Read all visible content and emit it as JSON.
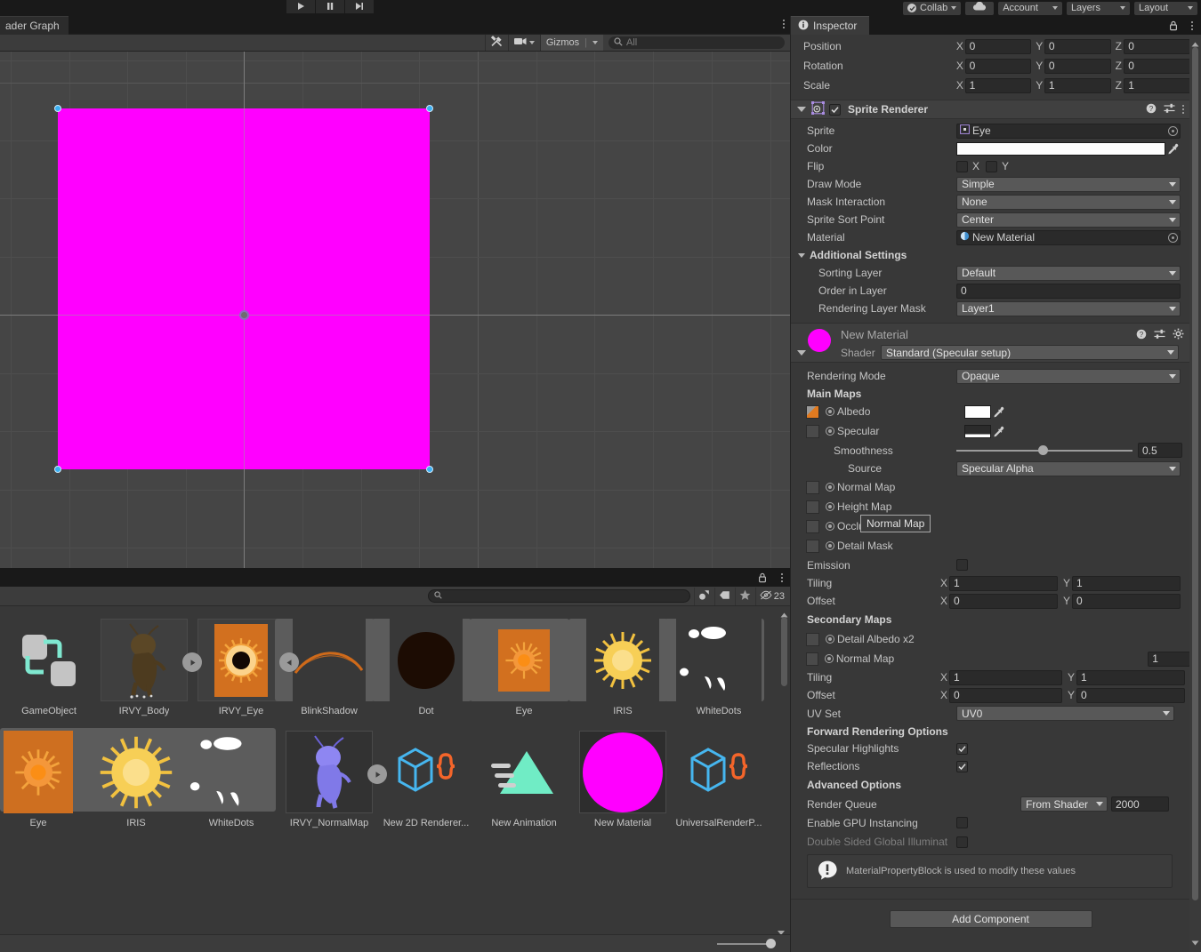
{
  "toolbar": {
    "play_icon": "play-icon",
    "pause_icon": "pause-icon",
    "step_icon": "step-icon",
    "collab_label": "Collab",
    "cloud_icon": "cloud-icon",
    "account_label": "Account",
    "layers_label": "Layers",
    "layout_label": "Layout"
  },
  "scene_panel": {
    "tab_label": "ader Graph",
    "tools_icon": "tools-icon",
    "camera_icon": "camera-icon",
    "gizmos_label": "Gizmos",
    "search_placeholder": "All",
    "search_icon": "search-icon",
    "sprite_color": "#ff00ff"
  },
  "project_panel": {
    "search_placeholder": "",
    "search_icon": "search-icon",
    "icon_filter_label": "filter-by-type-icon",
    "icon_label_label": "filter-by-label-icon",
    "icon_favorite_label": "favorite-star-icon",
    "hidden_icon": "hidden-eye-icon",
    "hidden_count": "23",
    "rows": [
      {
        "items": [
          {
            "name": "GameObject",
            "kind": "prefab",
            "selected": false
          },
          {
            "name": "IRVY_Body",
            "kind": "sprite-body",
            "selected": false,
            "badge": "play"
          },
          {
            "name": "IRVY_Eye",
            "kind": "sprite-eye",
            "selected": false,
            "badge": "back"
          },
          {
            "name": "BlinkShadow",
            "kind": "blink-shadow",
            "selected": false
          },
          {
            "name": "Dot",
            "kind": "dot",
            "selected": false
          },
          {
            "name": "Eye",
            "kind": "eye",
            "selected": false
          },
          {
            "name": "IRIS",
            "kind": "iris",
            "selected": false
          },
          {
            "name": "WhiteDots",
            "kind": "whitedots",
            "selected": false
          }
        ]
      },
      {
        "items": [
          {
            "name": "Eye",
            "kind": "eye",
            "selected": true
          },
          {
            "name": "IRIS",
            "kind": "iris",
            "selected": true
          },
          {
            "name": "WhiteDots",
            "kind": "whitedots",
            "selected": true
          },
          {
            "name": "IRVY_NormalMap",
            "kind": "normalmap-body",
            "selected": false,
            "badge": "play"
          },
          {
            "name": "New 2D Renderer...",
            "kind": "asset-json",
            "selected": false
          },
          {
            "name": "New Animation",
            "kind": "animation",
            "selected": false
          },
          {
            "name": "New Material",
            "kind": "material",
            "selected": true
          },
          {
            "name": "UniversalRenderP...",
            "kind": "asset-json",
            "selected": false
          }
        ]
      }
    ]
  },
  "inspector": {
    "tab_label": "Inspector",
    "info_icon": "info-icon",
    "lock_icon": "lock-icon",
    "kebab_icon": "kebab-icon",
    "transform": {
      "rows": [
        {
          "label": "Position",
          "x": "0",
          "y": "0",
          "z": "0"
        },
        {
          "label": "Rotation",
          "x": "0",
          "y": "0",
          "z": "0"
        },
        {
          "label": "Scale",
          "x": "1",
          "y": "1",
          "z": "1"
        }
      ],
      "axis_x": "X",
      "axis_y": "Y",
      "axis_z": "Z"
    },
    "sprite_renderer": {
      "title": "Sprite Renderer",
      "enabled": true,
      "icon": "sprite-renderer-icon",
      "help_icon": "help-icon",
      "preset_icon": "preset-icon",
      "kebab_icon": "kebab-icon",
      "sprite_label": "Sprite",
      "sprite_value": "Eye",
      "color_label": "Color",
      "color_value": "#ffffff",
      "eyedropper_icon": "eyedropper-icon",
      "flip_label": "Flip",
      "flip_x_label": "X",
      "flip_y_label": "Y",
      "flip_x": false,
      "flip_y": false,
      "draw_mode_label": "Draw Mode",
      "draw_mode_value": "Simple",
      "mask_interaction_label": "Mask Interaction",
      "mask_interaction_value": "None",
      "sort_point_label": "Sprite Sort Point",
      "sort_point_value": "Center",
      "material_label": "Material",
      "material_value": "New Material",
      "additional_settings_label": "Additional Settings",
      "sorting_layer_label": "Sorting Layer",
      "sorting_layer_value": "Default",
      "order_in_layer_label": "Order in Layer",
      "order_in_layer_value": "0",
      "rendering_layer_mask_label": "Rendering Layer Mask",
      "rendering_layer_mask_value": "Layer1"
    },
    "material": {
      "title": "New Material",
      "preview_color": "#ff00ff",
      "help_icon": "help-icon",
      "preset_icon": "preset-icon",
      "settings_icon": "gear-icon",
      "shader_label": "Shader",
      "shader_value": "Standard (Specular setup)",
      "rendering_mode_label": "Rendering Mode",
      "rendering_mode_value": "Opaque",
      "main_maps_label": "Main Maps",
      "albedo_label": "Albedo",
      "albedo_color": "#ffffff",
      "specular_label": "Specular",
      "specular_color": "#2a2a2a",
      "smoothness_label": "Smoothness",
      "smoothness_value": "0.5",
      "smoothness_fraction": 0.5,
      "source_label": "Source",
      "source_value": "Specular Alpha",
      "normal_map_label": "Normal Map",
      "height_map_label": "Height Map",
      "occlusion_label": "Occlusion",
      "detail_mask_label": "Detail Mask",
      "emission_label": "Emission",
      "emission_checked": false,
      "tiling_label": "Tiling",
      "tiling_x": "1",
      "tiling_y": "1",
      "offset_label": "Offset",
      "offset_x": "0",
      "offset_y": "0",
      "secondary_maps_label": "Secondary Maps",
      "detail_albedo_label": "Detail Albedo x2",
      "secondary_normal_map_label": "Normal Map",
      "secondary_normal_scale": "1",
      "sec_tiling_label": "Tiling",
      "sec_tiling_x": "1",
      "sec_tiling_y": "1",
      "sec_offset_label": "Offset",
      "sec_offset_x": "0",
      "sec_offset_y": "0",
      "uv_set_label": "UV Set",
      "uv_set_value": "UV0",
      "forward_rendering_label": "Forward Rendering Options",
      "specular_highlights_label": "Specular Highlights",
      "specular_highlights_checked": true,
      "reflections_label": "Reflections",
      "reflections_checked": true,
      "advanced_options_label": "Advanced Options",
      "render_queue_label": "Render Queue",
      "render_queue_mode": "From Shader",
      "render_queue_value": "2000",
      "gpu_instancing_label": "Enable GPU Instancing",
      "gpu_instancing_checked": false,
      "double_sided_gi_label": "Double Sided Global Illuminat",
      "double_sided_gi_checked": false,
      "helpbox_text": "MaterialPropertyBlock is used to modify these values",
      "warning_icon": "warning-icon"
    },
    "add_component_label": "Add Component",
    "tooltip_text": "Normal Map"
  }
}
